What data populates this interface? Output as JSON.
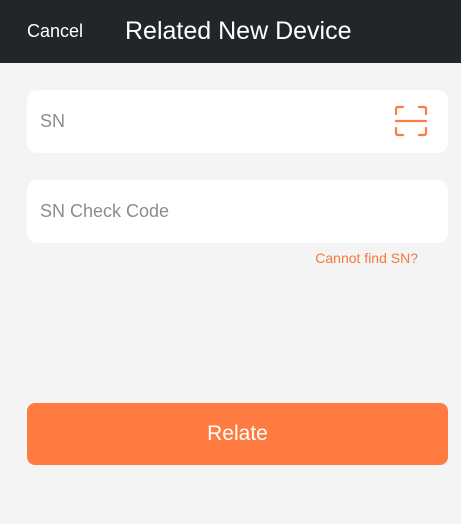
{
  "header": {
    "cancel_label": "Cancel",
    "title": "Related New Device"
  },
  "form": {
    "sn": {
      "value": "",
      "placeholder": "SN",
      "icon": "scan-icon"
    },
    "check_code": {
      "value": "",
      "placeholder": "SN Check Code"
    },
    "help_link": "Cannot find SN?",
    "submit_label": "Relate"
  },
  "colors": {
    "header_bg": "#222628",
    "page_bg": "#f4f4f4",
    "accent": "#ff7b41",
    "link": "#f37a3d"
  }
}
